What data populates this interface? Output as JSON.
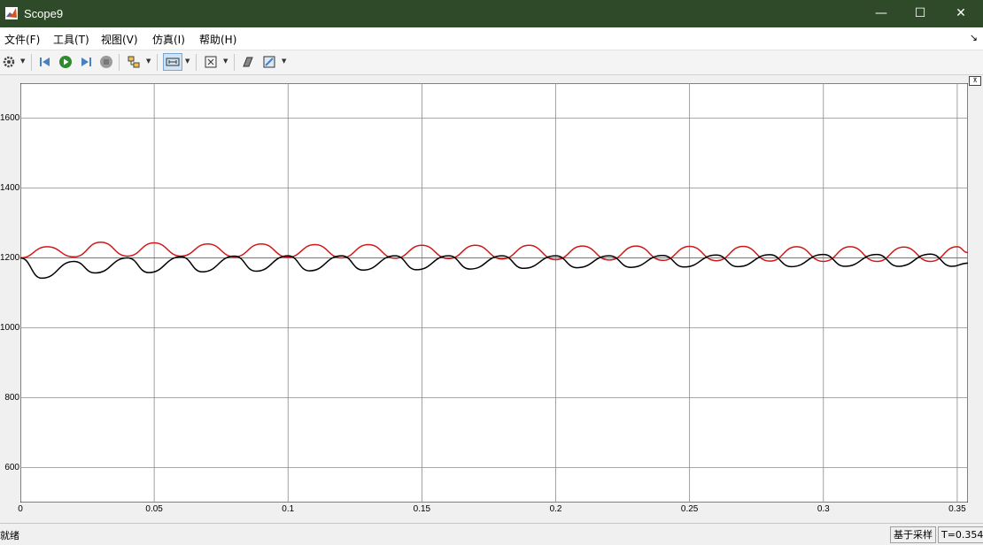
{
  "window": {
    "title": "Scope9",
    "minimize": "—",
    "maximize": "☐",
    "close": "✕"
  },
  "menu": [
    {
      "label": "文件(F)"
    },
    {
      "label": "工具(T)"
    },
    {
      "label": "视图(V)"
    },
    {
      "label": "仿真(I)"
    },
    {
      "label": "帮助(H)"
    }
  ],
  "toolbar": [
    "settings-icon",
    "step-back-icon",
    "run-icon",
    "step-forward-icon",
    "stop-icon",
    "signal-select-icon",
    "zoom-icon",
    "autoscale-icon",
    "cursor-measure-icon",
    "highlight-icon"
  ],
  "chart_data": {
    "type": "line",
    "title": "",
    "xlabel": "",
    "ylabel": "",
    "xlim": [
      0,
      0.354
    ],
    "ylim": [
      500,
      1700
    ],
    "xticks": [
      "0",
      "0.05",
      "0.1",
      "0.15",
      "0.2",
      "0.25",
      "0.3",
      "0.35"
    ],
    "yticks": [
      "600",
      "800",
      "1000",
      "1200",
      "1400",
      "1600"
    ],
    "grid": true,
    "reference_line": 1200,
    "series": [
      {
        "color": "#d01818",
        "x": [
          0,
          0.01,
          0.02,
          0.03,
          0.04,
          0.05,
          0.06,
          0.07,
          0.08,
          0.09,
          0.1,
          0.11,
          0.12,
          0.13,
          0.14,
          0.15,
          0.16,
          0.17,
          0.18,
          0.19,
          0.2,
          0.21,
          0.22,
          0.23,
          0.24,
          0.25,
          0.26,
          0.27,
          0.28,
          0.29,
          0.3,
          0.31,
          0.32,
          0.33,
          0.34,
          0.35,
          0.354
        ],
        "y": [
          1200,
          1232,
          1203,
          1245,
          1205,
          1243,
          1205,
          1240,
          1203,
          1240,
          1202,
          1238,
          1200,
          1238,
          1199,
          1236,
          1198,
          1236,
          1197,
          1236,
          1195,
          1234,
          1194,
          1234,
          1193,
          1233,
          1192,
          1233,
          1191,
          1232,
          1190,
          1232,
          1190,
          1231,
          1190,
          1232,
          1215
        ]
      },
      {
        "color": "#000000",
        "x": [
          0,
          0.008,
          0.02,
          0.028,
          0.04,
          0.048,
          0.06,
          0.068,
          0.08,
          0.088,
          0.1,
          0.108,
          0.12,
          0.128,
          0.14,
          0.148,
          0.16,
          0.168,
          0.18,
          0.188,
          0.2,
          0.208,
          0.22,
          0.228,
          0.24,
          0.248,
          0.26,
          0.268,
          0.28,
          0.288,
          0.3,
          0.308,
          0.32,
          0.328,
          0.34,
          0.348,
          0.354
        ],
        "y": [
          1200,
          1142,
          1190,
          1157,
          1200,
          1158,
          1203,
          1160,
          1205,
          1162,
          1206,
          1163,
          1206,
          1165,
          1206,
          1166,
          1206,
          1168,
          1206,
          1170,
          1206,
          1172,
          1206,
          1173,
          1207,
          1174,
          1208,
          1175,
          1209,
          1175,
          1210,
          1176,
          1210,
          1176,
          1211,
          1176,
          1185
        ]
      }
    ]
  },
  "expander": "⊼",
  "status": {
    "left": "就绪",
    "sampling": "基于采样",
    "time": "T=0.354"
  }
}
